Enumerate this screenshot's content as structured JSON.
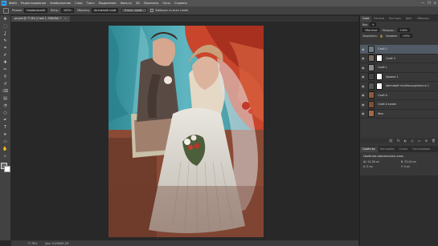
{
  "menubar": {
    "logo": "Ps",
    "items": [
      "Файл",
      "Редактирование",
      "Изображение",
      "Слои",
      "Текст",
      "Выделение",
      "Фильтр",
      "3D",
      "Просмотр",
      "Окно",
      "Справка"
    ],
    "window_controls": [
      "—",
      "❐",
      "✕"
    ]
  },
  "options": {
    "mode_label": "Режим:",
    "mode_value": "Нормальный",
    "opacity_label": "Непр.:",
    "opacity_value": "100%",
    "sample_label": "Образец:",
    "sample_value": "Активный слой",
    "btn_refine": "Уточн. край...",
    "checkbox_label": "Выборка со всех слоёв"
  },
  "document_tab": {
    "title": "рк.рsd @ 77,8% (Слой 2, RGB/8#) *",
    "close": "×"
  },
  "toolbar": {
    "tools": [
      "move-tool",
      "marquee-tool",
      "lasso-tool",
      "quick-select-tool",
      "crop-tool",
      "eyedropper-tool",
      "healing-tool",
      "brush-tool",
      "stamp-tool",
      "history-brush-tool",
      "eraser-tool",
      "gradient-tool",
      "blur-tool",
      "dodge-tool",
      "pen-tool",
      "type-tool",
      "path-select-tool",
      "shape-tool",
      "hand-tool",
      "zoom-tool"
    ],
    "glyphs": [
      "✥",
      "⬚",
      "ʆ",
      "✎",
      "⌗",
      "✐",
      "✚",
      "✏",
      "⚲",
      "↺",
      "⌫",
      "▤",
      "◔",
      "○",
      "✒",
      "T",
      "➤",
      "▭",
      "✋",
      "⌕"
    ]
  },
  "status": {
    "zoom": "77,78%",
    "doc": "Док: 9,03M/85,2M"
  },
  "panels": {
    "top_tabs": [
      "Слои",
      "Каналы",
      "Контуры",
      "Цвет",
      "Образцы"
    ],
    "kind_label": "Вид",
    "blend_mode": "Обычные",
    "opacity_label": "Непрозр.:",
    "opacity": "100%",
    "lock_label": "Закрепить:",
    "fill_label": "Заливка:",
    "fill": "100%",
    "layers": [
      {
        "name": "Слой 2",
        "selected": true,
        "mask": false,
        "thumb": "#6d7a82"
      },
      {
        "name": "Слой 3",
        "selected": false,
        "mask": true,
        "thumb": "#7a6a60"
      },
      {
        "name": "Слой 1",
        "selected": false,
        "mask": false,
        "thumb": "#8a8a8a"
      },
      {
        "name": "Уровни 1",
        "selected": false,
        "mask": true,
        "thumb": "#444"
      },
      {
        "name": "Цветовой тон/Насыщенность 1",
        "selected": false,
        "mask": true,
        "thumb": "#555"
      },
      {
        "name": "Слой 0",
        "selected": false,
        "mask": false,
        "thumb": "#8b5a3c"
      },
      {
        "name": "Слой 0 копия",
        "selected": false,
        "mask": false,
        "thumb": "#7b4f38"
      },
      {
        "name": "Фон",
        "selected": false,
        "mask": false,
        "thumb": "#9c6a4a"
      }
    ],
    "layer_footer": [
      "⛓",
      "fx",
      "◐",
      "◎",
      "▭",
      "⊞",
      "🗑"
    ],
    "props_tabs": [
      "Свойства",
      "Настройки",
      "Стили",
      "Гистограмма"
    ],
    "props_title": "Свойства пиксельного слоя",
    "props_fields": [
      "Ш: 24,38 см",
      "В: 33,04 см",
      "X: 0 см",
      "Y: 0 см"
    ]
  }
}
